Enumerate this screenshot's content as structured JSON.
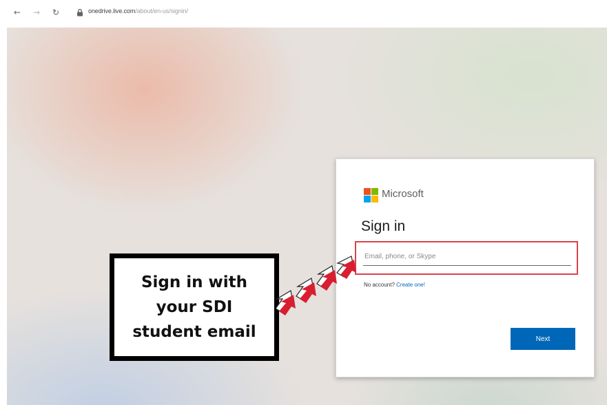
{
  "browser": {
    "back_icon": "arrow-left-icon",
    "forward_icon": "arrow-right-icon",
    "reload_icon": "reload-icon",
    "lock_icon": "lock-icon",
    "url_host": "onedrive.live.com",
    "url_path": "/about/en-us/signin/"
  },
  "signin": {
    "brand": "Microsoft",
    "title": "Sign in",
    "email_placeholder": "Email, phone, or Skype",
    "no_account": "No account?",
    "create_link": "Create one!",
    "next_label": "Next",
    "logo_colors": [
      "#f25022",
      "#7fba00",
      "#00a4ef",
      "#ffb900"
    ],
    "accent": "#0067b8",
    "highlight_color": "#d9434a"
  },
  "annotation": {
    "lines": [
      "Sign in with",
      "your SDI",
      "student email"
    ],
    "arrow_color": "#d81f32"
  }
}
